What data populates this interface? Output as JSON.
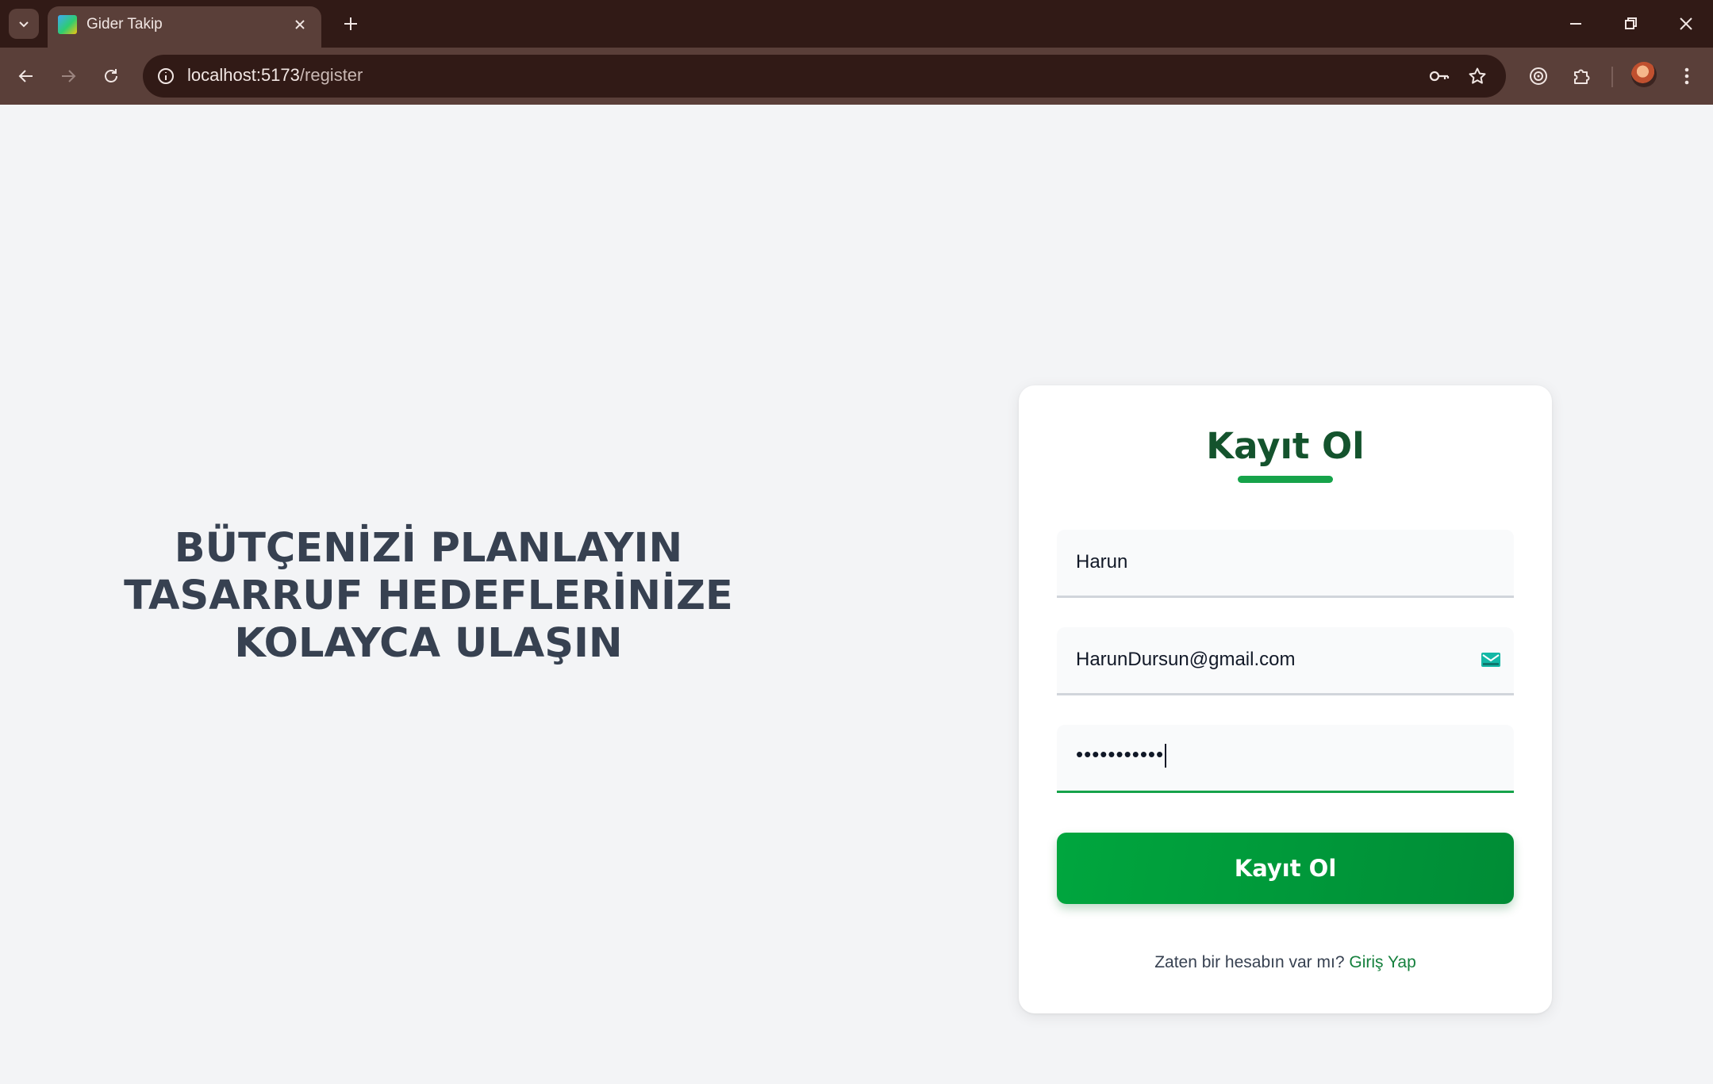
{
  "browser": {
    "tab": {
      "title": "Gider Takip"
    },
    "url": {
      "host": "localhost:5173",
      "path": "/register"
    }
  },
  "page": {
    "hero_lines": [
      "BÜTÇENİZİ PLANLAYIN",
      "TASARRUF HEDEFLERİNİZE",
      "KOLAYCA ULAŞIN"
    ]
  },
  "form": {
    "title": "Kayıt Ol",
    "name_value": "Harun",
    "email_value": "HarunDursun@gmail.com",
    "password_mask": "•••••••••••",
    "submit_label": "Kayıt Ol",
    "footer_prompt": "Zaten bir hesabın var mı?",
    "footer_link": "Giriş Yap"
  },
  "colors": {
    "accent_green": "#16a34a",
    "title_green": "#14532d",
    "chrome_dark": "#311a16",
    "chrome_mid": "#5a3f39"
  },
  "icons": {
    "email_field": "mail-icon"
  }
}
